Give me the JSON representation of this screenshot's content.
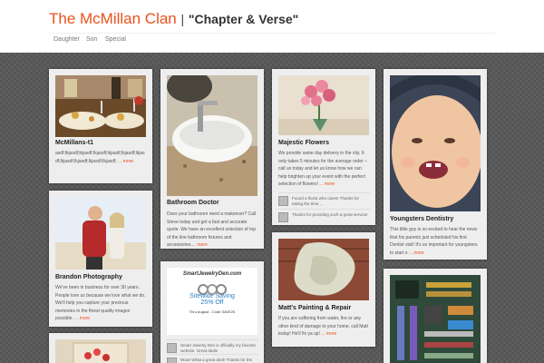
{
  "site": {
    "title": "The McMillan Clan",
    "separator": "|",
    "tagline": "\"Chapter & Verse\""
  },
  "nav": [
    "Daughter",
    "Son",
    "Special"
  ],
  "cards": {
    "mcmillans": {
      "title": "McMillans-t1",
      "text": "asdf;lkjasdf;lkjasdf;lkjasdf;lkjasdf;lkjasdf;lkjasdf;lkjasdf;lkjasdf;lkjasdf;lkjasdf;",
      "more": "... more"
    },
    "bathroom": {
      "title": "Bathroom Doctor",
      "text": "Does your bathroom need a makeover? Call Steve today and get a fast and accurate quote. We have an excellent selection of top of the line bathroom fixtures and accessories....",
      "more": "more"
    },
    "flowers": {
      "title": "Majestic Flowers",
      "text": "We provide same day delivery in the city. It only takes 5 minutes for the average order – call us today and let us know how we can help brighten up your event with the perfect selection of flowers!",
      "more": "... more",
      "comments": [
        "Found a florist who cares! Thanks for taking the time....",
        "Thanks for providing such a great service!"
      ]
    },
    "youngsters": {
      "title": "Youngsters Dentistry",
      "text": "This little guy is so excited to hear the news that his parents just scheduled his first Dentist visit! It's so important for youngsters to start o",
      "more": "... more"
    },
    "brandon": {
      "title": "Brandon Photography",
      "text": "We've been in business for over 30 years. People love us because we love what we do. We'll help you capture your precious memories in the finest quality images possible.",
      "more": "... more"
    },
    "jewelry": {
      "ad_name": "SmartJewelryDen.com",
      "ad_save": "Sitewide Saving",
      "ad_pct": "25% Off",
      "ad_promo": "Thru August - Code SAVE25",
      "comments": [
        "Smart Jewelry Den is officially my favorite website. Great deals",
        "Wow! What a great deal! Thanks for the"
      ]
    },
    "painting": {
      "title": "Matt's Painting & Repair",
      "text": "If you are suffering from water, fire or any other kind of damage to your home, call Matt today! He'll fix ya up!",
      "more": "... more"
    }
  }
}
